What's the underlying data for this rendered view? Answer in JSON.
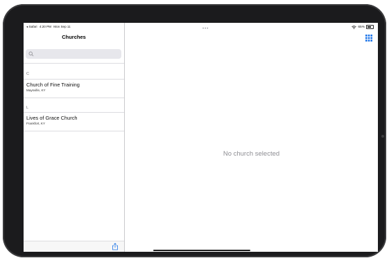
{
  "status_bar": {
    "back_app": "◂ Safari",
    "time": "4:20 PM",
    "date": "Mon Sep 11",
    "multitask": "•••",
    "battery": "65%",
    "battery_level": 0.65
  },
  "sidebar": {
    "title": "Churches",
    "search": {
      "placeholder": "",
      "value": ""
    },
    "sections": [
      {
        "letter": "C",
        "items": [
          {
            "name": "Church of Fine Training",
            "location": "Maysville, KY"
          }
        ]
      },
      {
        "letter": "L",
        "items": [
          {
            "name": "Lives of Grace Church",
            "location": "Frankfort, KY"
          }
        ]
      }
    ]
  },
  "detail": {
    "empty_message": "No church selected"
  },
  "icons": {
    "search": "search-icon",
    "share": "share-icon",
    "grid": "grid-icon",
    "wifi": "wifi-icon",
    "battery": "battery-icon"
  },
  "colors": {
    "accent": "#1a73e8",
    "empty_text": "#8e8e93"
  }
}
